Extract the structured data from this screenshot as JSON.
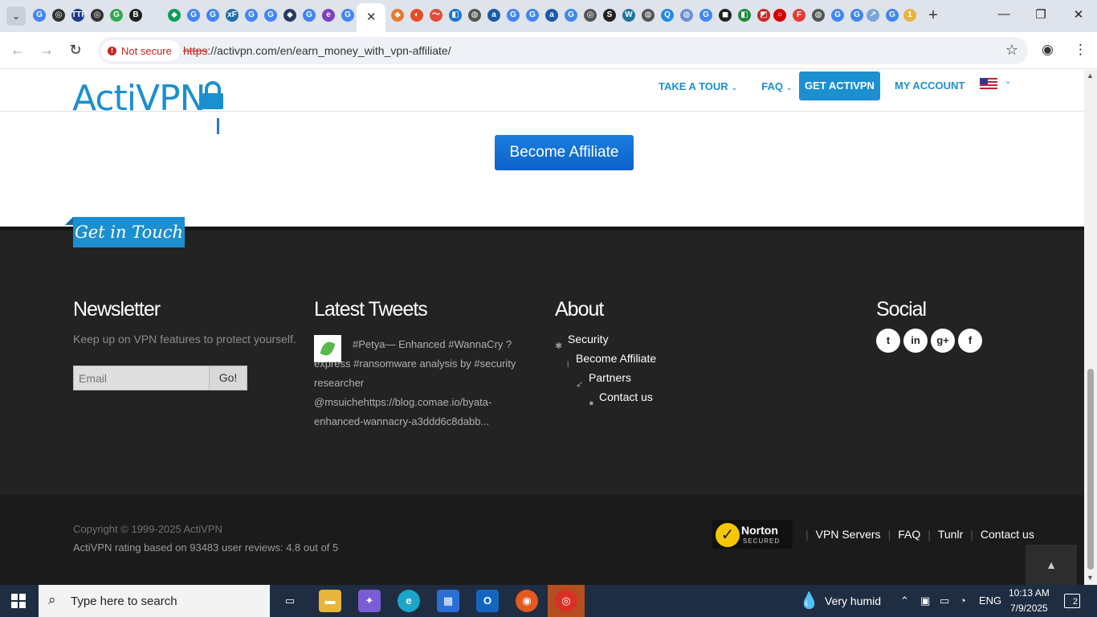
{
  "browser": {
    "url_scheme": "https",
    "url_rest": "://activpn.com/en/earn_money_with_vpn-affiliate/",
    "security_label": "Not secure",
    "active_tab_close": "✕",
    "new_tab": "+",
    "tab_icons": [
      "G",
      "◎",
      "TTP",
      "◎",
      "G",
      "B",
      "◆",
      "G",
      "G",
      "xF",
      "G",
      "G",
      "◆",
      "G",
      "e",
      "G",
      "◆",
      "◐",
      "〜",
      "◧",
      "◍",
      "a",
      "G",
      "G",
      "a",
      "G",
      "◎",
      "S",
      "W",
      "◍",
      "Q",
      "◍",
      "G",
      "◼",
      "◧",
      "◩",
      "○",
      "F",
      "◍",
      "G",
      "G",
      "↗",
      "G",
      "1"
    ]
  },
  "header": {
    "logo": "ActiVPN",
    "nav": {
      "tour": "TAKE A TOUR",
      "faq": "FAQ",
      "get": "GET ACTIVPN",
      "account": "MY ACCOUNT"
    }
  },
  "main": {
    "affiliate_button": "Become Affiliate"
  },
  "footer": {
    "get_in_touch": "Get in Touch",
    "newsletter": {
      "title": "Newsletter",
      "desc": "Keep up on VPN features to protect yourself.",
      "placeholder": "Email",
      "go": "Go!"
    },
    "tweets": {
      "title": "Latest Tweets",
      "text": "#Petya— Enhanced #WannaCry ? express #ransomware analysis by #security researcher @msuichehttps://blog.comae.io/byata-enhanced-wannacry-a3ddd6c8dabb..."
    },
    "about": {
      "title": "About",
      "items": [
        "Security",
        "Become Affiliate",
        "Partners",
        "Contact us"
      ]
    },
    "social": {
      "title": "Social",
      "icons": [
        "twitter-icon",
        "linkedin-icon",
        "google-plus-icon",
        "facebook-icon"
      ]
    },
    "copyright": "Copyright © 1999-2025 ActiVPN",
    "rating": "ActiVPN rating based on 93483 user reviews: 4.8 out of 5",
    "norton": {
      "name": "Norton",
      "sub": "SECURED"
    },
    "links": [
      "VPN Servers",
      "FAQ",
      "Tunlr",
      "Contact us"
    ]
  },
  "taskbar": {
    "search_placeholder": "Type here to search",
    "weather": "Very humid",
    "lang": "ENG",
    "time": "10:13 AM",
    "date": "7/9/2025",
    "notifications": "2"
  },
  "colors": {
    "brand": "#1c8fd0",
    "footer": "#232323",
    "button": "#0d61c7"
  }
}
